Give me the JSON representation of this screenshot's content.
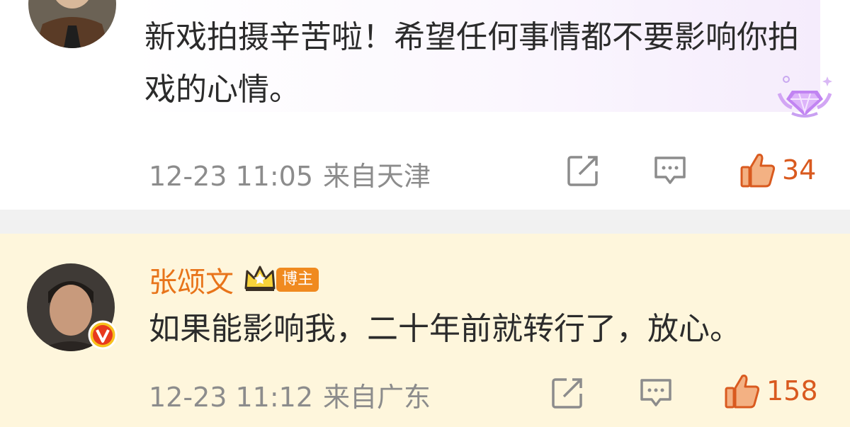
{
  "comments": [
    {
      "text": "新戏拍摄辛苦啦！希望任何事情都不要影响你拍戏的心情。",
      "date": "12-23 11:05",
      "location": "来自天津",
      "likes": "34"
    },
    {
      "username": "张颂文",
      "role_badge": "博主",
      "text": "如果能影响我，二十年前就转行了，放心。",
      "date": "12-23 11:12",
      "location": "来自广东",
      "likes": "158"
    }
  ],
  "icons": {
    "share": "share-icon",
    "reply": "comment-icon",
    "like": "thumbs-up-icon",
    "gem": "gem-badge-icon",
    "crown": "crown-icon",
    "verified": "verified-v-icon"
  },
  "colors": {
    "like_accent": "#d95a1f",
    "username": "#e8741a",
    "highlight_bg": "#fef6dc"
  }
}
